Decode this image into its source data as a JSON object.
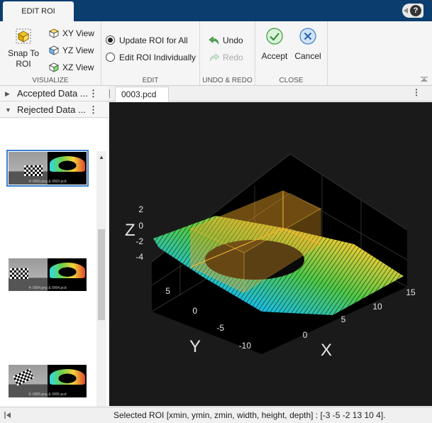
{
  "toolstrip": {
    "tab_label": "EDIT ROI",
    "help_label": "?",
    "visualize": {
      "label": "VISUALIZE",
      "snap_label_1": "Snap To",
      "snap_label_2": "ROI",
      "xy_view": "XY View",
      "yz_view": "YZ View",
      "xz_view": "XZ View"
    },
    "edit": {
      "label": "EDIT",
      "update_all": "Update ROI for All",
      "edit_individually": "Edit ROI Individually",
      "selected": "update_all"
    },
    "undo_redo": {
      "label": "UNDO & REDO",
      "undo": "Undo",
      "redo": "Redo",
      "redo_enabled": false
    },
    "close": {
      "label": "CLOSE",
      "accept": "Accept",
      "cancel": "Cancel"
    }
  },
  "left_panel": {
    "accepted_header": "Accepted Data ...",
    "rejected_header": "Rejected Data ...",
    "items": [
      {
        "caption": "4: 0003.png & 0003.pcd",
        "selected": true
      },
      {
        "caption": "4: 0004.png & 0004.pcd",
        "selected": false
      },
      {
        "caption": "5: 0005.png & 0005.pcd",
        "selected": false
      }
    ]
  },
  "document": {
    "tab_label": "0003.pcd"
  },
  "plot": {
    "z_ticks": [
      "2",
      "0",
      "-2",
      "-4"
    ],
    "y_ticks": [
      "5",
      "0",
      "-5",
      "-10"
    ],
    "x_ticks": [
      "0",
      "5",
      "10",
      "15"
    ],
    "x_label": "X",
    "y_label": "Y",
    "z_label": "Z",
    "roi": {
      "xmin": -3,
      "ymin": -5,
      "zmin": -2,
      "width": 13,
      "height": 10,
      "depth": 4
    },
    "colors": {
      "background": "#1a1a1a",
      "roi_face": "#f2a627",
      "axis_text": "#e6e6e6"
    }
  },
  "status": {
    "text": "Selected ROI [xmin, ymin, zmin, width, height, depth] : [-3 -5 -2 13 10 4]."
  },
  "icons": [
    "snap-to-roi-icon",
    "xy-view-icon",
    "yz-view-icon",
    "xz-view-icon",
    "undo-icon",
    "redo-icon",
    "accept-icon",
    "cancel-icon",
    "help-icon"
  ]
}
